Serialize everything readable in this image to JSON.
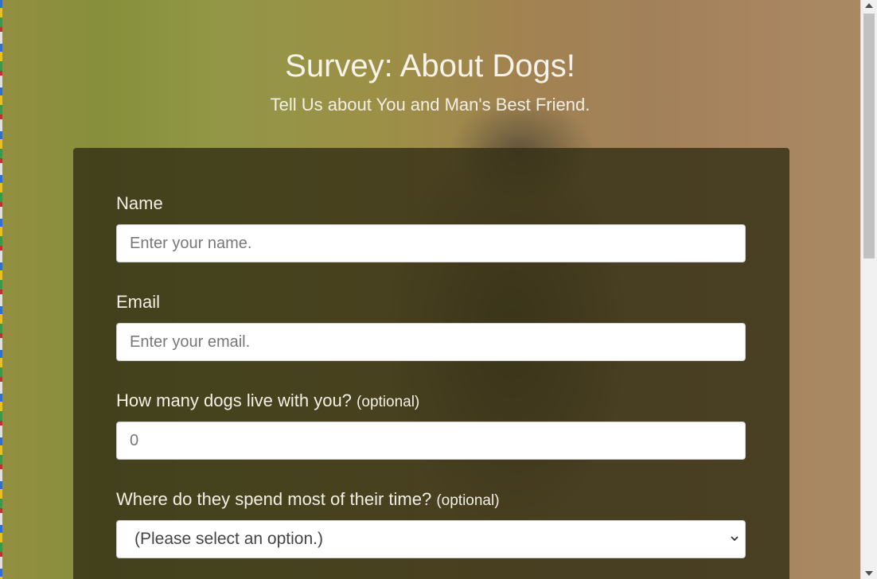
{
  "header": {
    "title": "Survey: About Dogs!",
    "subtitle": "Tell Us about You and Man's Best Friend."
  },
  "form": {
    "name": {
      "label": "Name",
      "placeholder": "Enter your name."
    },
    "email": {
      "label": "Email",
      "placeholder": "Enter your email."
    },
    "dog_count": {
      "label": "How many dogs live with you?",
      "optional_tag": "(optional)",
      "placeholder": "0"
    },
    "location": {
      "label": "Where do they spend most of their time?",
      "optional_tag": "(optional)",
      "selected": "(Please select an option.)"
    }
  },
  "icons": {
    "select_arrow": "chevron-down-icon",
    "scroll_up": "scroll-up-arrow-icon",
    "scroll_down": "scroll-down-arrow-icon"
  },
  "colors": {
    "panel_bg": "#34301680",
    "text_light": "#f3efe4"
  }
}
